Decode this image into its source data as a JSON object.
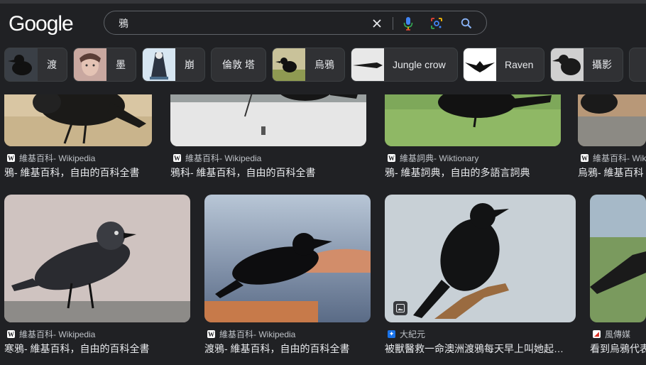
{
  "header": {
    "logo": "Google",
    "search": {
      "query": "鴉"
    }
  },
  "icons": {
    "clear": "close-icon",
    "voice": "microphone-icon",
    "lens": "google-lens-icon",
    "search": "search-icon"
  },
  "chips": [
    {
      "label": "渡"
    },
    {
      "label": "墨"
    },
    {
      "label": "崩"
    },
    {
      "label": "倫敦 塔"
    },
    {
      "label": "烏鴉"
    },
    {
      "label": "Jungle crow"
    },
    {
      "label": "Raven"
    },
    {
      "label": "攝影"
    }
  ],
  "results_row1": [
    {
      "source": "維基百科- Wikipedia",
      "title": "鴉- 維基百科，自由的百科全書"
    },
    {
      "source": "維基百科- Wikipedia",
      "title": "鴉科- 維基百科，自由的百科全書"
    },
    {
      "source": "維基詞典- Wiktionary",
      "title": "鴉- 維基詞典，自由的多語言詞典"
    },
    {
      "source": "維基百科- Wiki",
      "title": "烏鴉- 維基百科"
    }
  ],
  "results_row2": [
    {
      "source": "維基百科- Wikipedia",
      "title": "寒鴉- 維基百科，自由的百科全書"
    },
    {
      "source": "維基百科- Wikipedia",
      "title": "渡鴉- 維基百科，自由的百科全書"
    },
    {
      "source": "大紀元",
      "title": "被獸醫救一命澳洲渡鴉每天早上叫她起…"
    },
    {
      "source": "風傳媒",
      "title": "看到烏鴉代表"
    }
  ],
  "colors": {
    "background": "#202124",
    "chip_bg": "#303134",
    "text": "#e8eaed",
    "muted": "#bdc1c6"
  }
}
